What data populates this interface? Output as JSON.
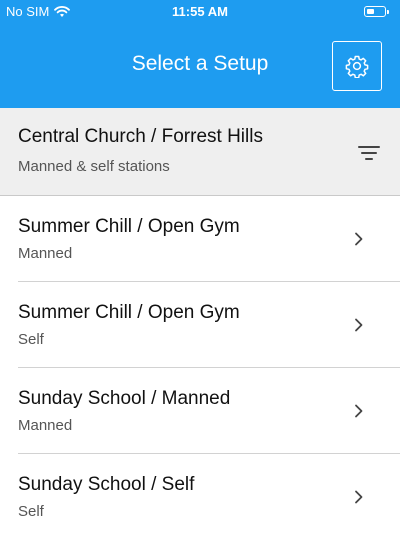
{
  "status_bar": {
    "carrier": "No SIM",
    "time": "11:55 AM",
    "battery_level": 0.45
  },
  "nav": {
    "title": "Select a Setup",
    "settings_icon": "gear-icon"
  },
  "site": {
    "title": "Central Church / Forrest Hills",
    "subtitle": "Manned & self stations",
    "filter_icon": "filter-icon"
  },
  "setups": [
    {
      "title": "Summer Chill / Open Gym",
      "subtitle": "Manned"
    },
    {
      "title": "Summer Chill / Open Gym",
      "subtitle": "Self"
    },
    {
      "title": "Sunday School / Manned",
      "subtitle": "Manned"
    },
    {
      "title": "Sunday School / Self",
      "subtitle": "Self"
    }
  ],
  "colors": {
    "accent": "#1e9cf0",
    "header_bg": "#efefef"
  }
}
